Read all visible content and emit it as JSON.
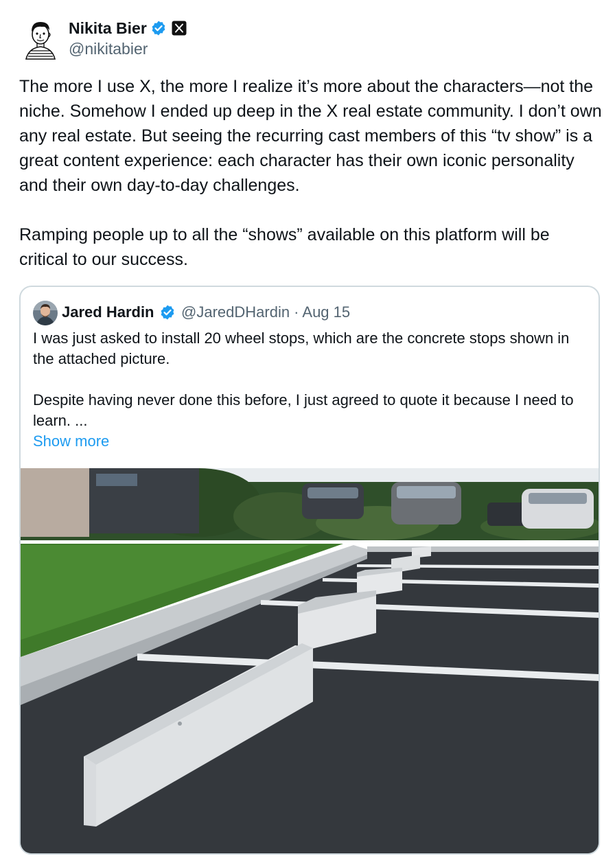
{
  "author": {
    "name": "Nikita Bier",
    "handle": "@nikitabier"
  },
  "tweet": {
    "paragraphs": [
      "The more I use X, the more I realize it’s more about the characters—not the niche. Somehow I ended up deep in the X real estate community. I don’t own any real estate. But seeing the recurring cast members of this “tv show” is a great content experience: each character has their own iconic personality and their own day-to-day challenges.",
      "Ramping people up to all the “shows” available on this platform will be critical to our success."
    ]
  },
  "quote": {
    "name": "Jared Hardin",
    "meta": "@JaredDHardin · Aug 15",
    "paragraphs": [
      "I was just asked to install 20 wheel stops, which are the concrete stops shown in the attached picture.",
      "Despite having never done this before, I just agreed to quote it because I need to learn. ..."
    ],
    "show_more": "Show more"
  },
  "colors": {
    "accent": "#1d9bf0",
    "text": "#0f1419",
    "secondary": "#536471",
    "border": "#cfd9de"
  },
  "icons": {
    "verified": "verified-badge-icon",
    "affiliate": "x-logo-icon"
  }
}
